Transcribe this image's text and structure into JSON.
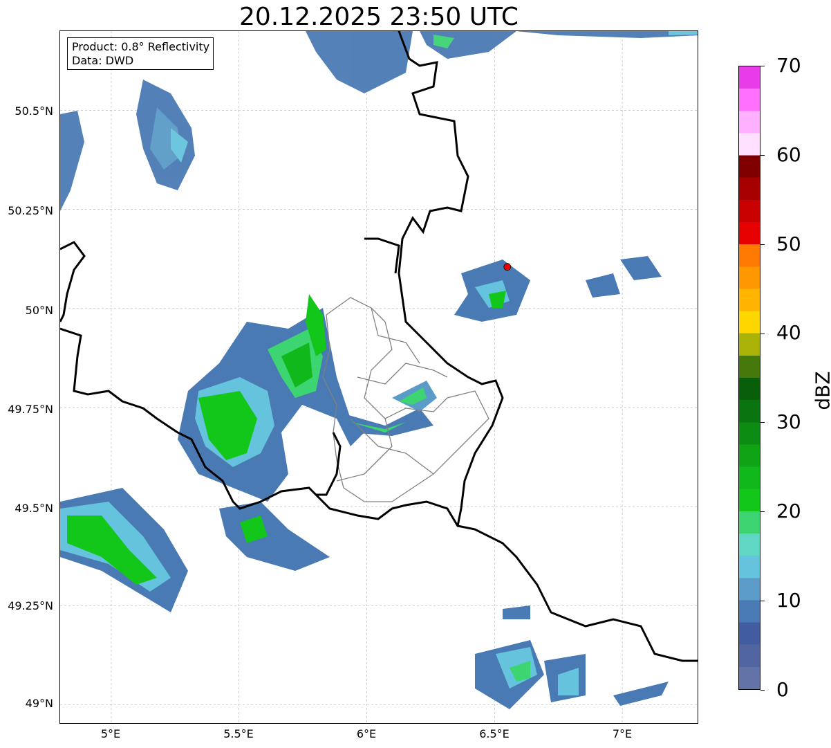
{
  "title": "20.12.2025 23:50 UTC",
  "info": {
    "product_line": "Product: 0.8° Reflectivity",
    "data_line": "Data: DWD"
  },
  "axes": {
    "lat_labels": [
      "50.5°N",
      "50.25°N",
      "50°N",
      "49.75°N",
      "49.5°N",
      "49.25°N",
      "49°N"
    ],
    "lat_values": [
      50.5,
      50.25,
      50.0,
      49.75,
      49.5,
      49.25,
      49.0
    ],
    "lon_labels": [
      "5°E",
      "5.5°E",
      "6°E",
      "6.5°E",
      "7°E"
    ],
    "lon_values": [
      5.0,
      5.5,
      6.0,
      6.5,
      7.0
    ],
    "lon_range": [
      4.8,
      7.3
    ],
    "lat_range": [
      48.95,
      50.7
    ],
    "gridlines": true
  },
  "colorbar": {
    "unit_label": "dBZ",
    "tick_labels": [
      "0",
      "10",
      "20",
      "30",
      "40",
      "50",
      "60",
      "70"
    ],
    "tick_values": [
      0,
      10,
      20,
      30,
      40,
      50,
      60,
      70
    ],
    "range": [
      0,
      70
    ],
    "colors": [
      "#6473a7",
      "#5166a0",
      "#415da0",
      "#4a7ab4",
      "#5a9bc8",
      "#65c3dd",
      "#5fd7c4",
      "#3dd472",
      "#12c61a",
      "#11b81b",
      "#0fa316",
      "#0c8c13",
      "#0a7410",
      "#095e0a",
      "#46780b",
      "#abb208",
      "#ffd700",
      "#ffb400",
      "#ff9700",
      "#ff7a00",
      "#e60000",
      "#c80000",
      "#a60000",
      "#800000",
      "#ffe0ff",
      "#ffb0ff",
      "#ff70ff",
      "#e83ce8"
    ]
  },
  "marker": {
    "lon": 6.55,
    "lat": 50.105,
    "color": "#ee0000"
  },
  "colors": {
    "border": "#000000",
    "admin_border": "#808080",
    "grid": "#b0b0b0"
  }
}
